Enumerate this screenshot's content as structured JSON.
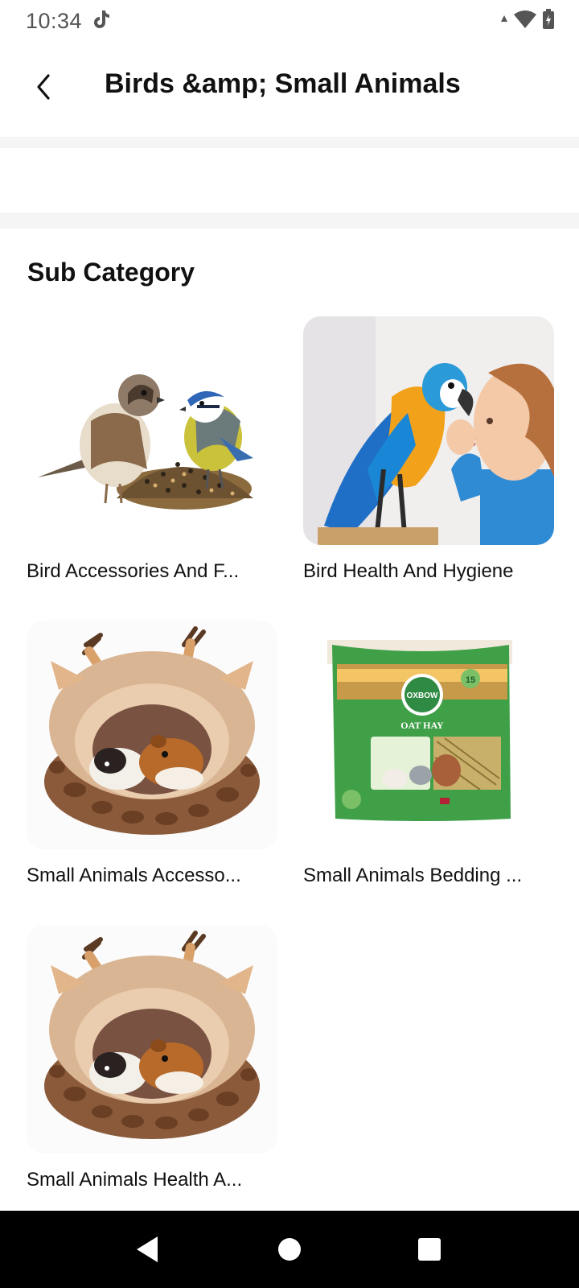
{
  "status_bar": {
    "time": "10:34",
    "icons": [
      "tiktok-icon",
      "signal-icon",
      "wifi-icon",
      "battery-icon"
    ]
  },
  "app_bar": {
    "title": "Birds &amp; Small Animals",
    "back_icon": "chevron-left-icon"
  },
  "section": {
    "title": "Sub Category"
  },
  "subcategories": [
    {
      "label": "Bird Accessories And F...",
      "image": "sparrows-with-seeds"
    },
    {
      "label": "Bird Health And Hygiene",
      "image": "macaw-with-child"
    },
    {
      "label": "Small Animals Accesso...",
      "image": "guinea-pig-bed"
    },
    {
      "label": "Small Animals Bedding ...",
      "image": "oat-hay-bag"
    },
    {
      "label": "Small Animals Health A...",
      "image": "guinea-pig-bed"
    }
  ],
  "hay_bag": {
    "brand": "OXBOW",
    "product": "OAT HAY",
    "weight": "15"
  },
  "nav_bar": {
    "icons": [
      "back-triangle-icon",
      "home-circle-icon",
      "recents-square-icon"
    ]
  }
}
